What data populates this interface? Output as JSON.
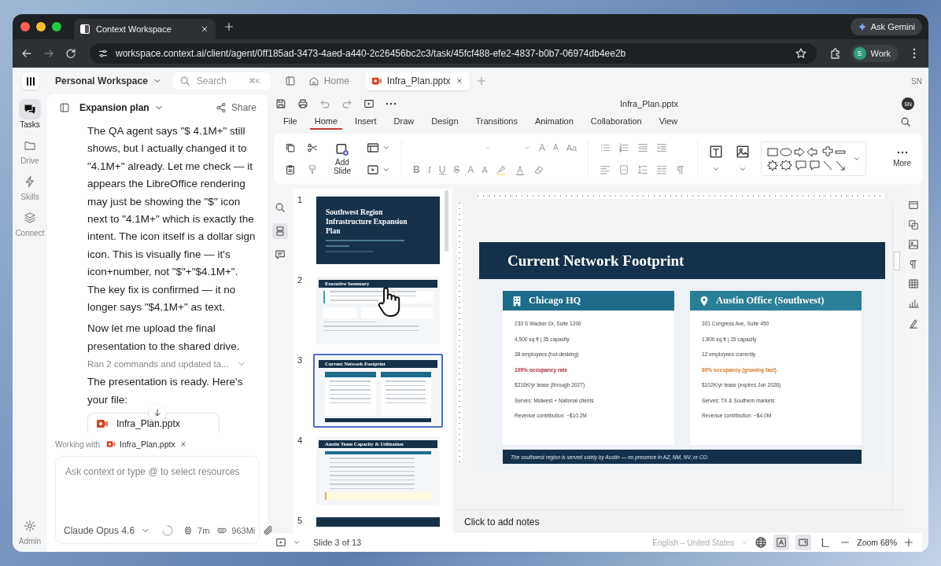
{
  "browser": {
    "tab": {
      "title": "Context Workspace",
      "selected": true
    },
    "ask_button": "Ask Gemini",
    "url": "workspace.context.ai/client/agent/0ff185ad-3473-4aed-a440-2c26456bc2c3/task/45fcf488-efe2-4837-b0b7-06974db4ee2b",
    "profile_initial": "S",
    "profile": "Work"
  },
  "app_bar": {
    "workspace": "Personal Workspace",
    "search": {
      "placeholder": "Search",
      "shortcut": "⌘K"
    },
    "tabs": [
      {
        "label": "Home",
        "kind": "home",
        "selected": false
      },
      {
        "label": "Infra_Plan.pptx",
        "kind": "file",
        "selected": true
      }
    ],
    "user_initials": "SN"
  },
  "rail": [
    {
      "label": "Tasks",
      "kind": "chat",
      "selected": true
    },
    {
      "label": "Drive",
      "kind": "folder",
      "selected": false
    },
    {
      "label": "Skills",
      "kind": "bolt",
      "selected": false
    },
    {
      "label": "Connect",
      "kind": "layers",
      "selected": false
    },
    {
      "label": "Admin",
      "kind": "gear",
      "selected": false
    }
  ],
  "chat": {
    "title": "Expansion plan",
    "share": "Share",
    "messages": [
      {
        "kind": "text",
        "text": "The QA agent says \"$ 4.1M+\" still shows, but I actually changed it to \"4.1M+\" already. Let me check — it appears the LibreOffice rendering may just be showing the \"$\" icon next to \"4.1M+\" which is exactly the intent. The icon itself is a dollar sign icon. This is visually fine — it's icon+number, not \"$\"+\"$4.1M+\". The key fix is confirmed — it no longer says \"$4.1M+\" as text."
      },
      {
        "kind": "text",
        "text": "Now let me upload the final presentation to the shared drive."
      },
      {
        "kind": "activity",
        "text": "Ran 2 commands and updated ta..."
      },
      {
        "kind": "text",
        "text": "The presentation is ready. Here's your file:"
      },
      {
        "kind": "file",
        "text": "Infra_Plan.pptx"
      }
    ],
    "working_with": {
      "label": "Working with",
      "file": "Infra_Plan.pptx"
    },
    "input": {
      "placeholder": "Ask context or type @ to select resources"
    },
    "model": "Claude Opus 4.6",
    "time": "7m",
    "memory": "963Mi"
  },
  "document": {
    "title": "Infra_Plan.pptx",
    "user_initials": "SN",
    "menu": [
      {
        "label": "File",
        "selected": false
      },
      {
        "label": "Home",
        "selected": true
      },
      {
        "label": "Insert",
        "selected": false
      },
      {
        "label": "Draw",
        "selected": false
      },
      {
        "label": "Design",
        "selected": false
      },
      {
        "label": "Transitions",
        "selected": false
      },
      {
        "label": "Animation",
        "selected": false
      },
      {
        "label": "Collaboration",
        "selected": false
      },
      {
        "label": "View",
        "selected": false
      }
    ],
    "ribbon": {
      "add_slide": "Add Slide",
      "more": "More",
      "size_glyphs": [
        {
          "label": "A",
          "kind": "grow"
        },
        {
          "label": "A",
          "kind": "shrink"
        },
        {
          "label": "Aa",
          "kind": "case"
        }
      ],
      "format_glyphs": [
        {
          "label": "B",
          "kind": "bold"
        },
        {
          "label": "I",
          "kind": "italic"
        },
        {
          "label": "U",
          "kind": "underline"
        },
        {
          "label": "S",
          "kind": "strike"
        },
        {
          "label": "A",
          "kind": "super"
        },
        {
          "label": "A",
          "kind": "sub"
        }
      ]
    },
    "panel_tools": [
      {
        "kind": "search",
        "selected": false
      },
      {
        "kind": "slides",
        "selected": true
      },
      {
        "kind": "comments",
        "selected": false
      }
    ],
    "slides": [
      {
        "number": "1",
        "kind": "cover",
        "title": "Southwest Region Infrastructure Expansion Plan",
        "selected": false
      },
      {
        "number": "2",
        "kind": "summary",
        "title": "Executive Summary",
        "selected": false
      },
      {
        "number": "3",
        "kind": "columns",
        "title": "Current Network Footprint",
        "selected": true
      },
      {
        "number": "4",
        "kind": "table",
        "title": "Austin Team Capacity & Utilization",
        "selected": false
      },
      {
        "number": "5",
        "kind": "partial",
        "selected": false
      }
    ],
    "current_slide": {
      "title": "Current Network Footprint",
      "cards": [
        {
          "kind": "building",
          "heading": "Chicago HQ",
          "rows": [
            {
              "text": "233 S Wacker Dr, Suite 1200",
              "kind": "plain"
            },
            {
              "text": "4,500 sq ft | 35 capacity",
              "kind": "plain"
            },
            {
              "text": "38 employees (hot-desking)",
              "kind": "plain"
            },
            {
              "text": "109% occupancy rate",
              "kind": "critical"
            },
            {
              "text": "$216K/yr lease (through 2027)",
              "kind": "plain"
            },
            {
              "text": "Serves: Midwest + National clients",
              "kind": "plain"
            },
            {
              "text": "Revenue contribution: ~$10.2M",
              "kind": "plain"
            }
          ]
        },
        {
          "kind": "pin",
          "heading": "Austin Office (Southwest)",
          "rows": [
            {
              "text": "301 Congress Ave, Suite 450",
              "kind": "plain"
            },
            {
              "text": "1,800 sq ft | 15 capacity",
              "kind": "plain"
            },
            {
              "text": "12 employees currently",
              "kind": "plain"
            },
            {
              "text": "80% occupancy (growing fast)",
              "kind": "caution"
            },
            {
              "text": "$102K/yr lease (expires Jun 2026)",
              "kind": "plain"
            },
            {
              "text": "Serves: TX & Southern markets",
              "kind": "plain"
            },
            {
              "text": "Revenue contribution: ~$4.0M",
              "kind": "plain"
            }
          ]
        }
      ],
      "footer": "The southwest region is served solely by Austin — no presence in AZ, NM, NV, or CO."
    },
    "notes_placeholder": "Click to add notes",
    "status": {
      "slide": "Slide 3 of 13",
      "language": "English – United States",
      "zoom": "Zoom 68%",
      "view_toggles": [
        {
          "kind": "spell",
          "selected": true
        },
        {
          "kind": "normal",
          "selected": true
        },
        {
          "kind": "notes",
          "selected": false
        }
      ]
    }
  }
}
